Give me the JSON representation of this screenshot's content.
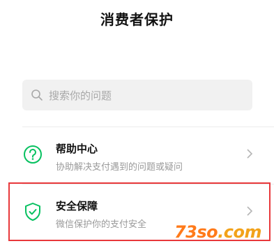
{
  "header": {
    "title": "消费者保护"
  },
  "search": {
    "placeholder": "搜索你的问题",
    "icon": "search-icon"
  },
  "items": [
    {
      "title": "帮助中心",
      "subtitle": "协助解决支付遇到的问题或疑问",
      "icon": "question-circle-icon"
    },
    {
      "title": "安全保障",
      "subtitle": "微信保护你的支付安全",
      "icon": "shield-check-icon"
    }
  ],
  "watermark": {
    "part1": "73so",
    "part2": ".com"
  },
  "colors": {
    "accent": "#07c160",
    "highlight": "#e8383b",
    "watermark1": "#ff7a1a",
    "watermark2": "#f2a21a"
  }
}
